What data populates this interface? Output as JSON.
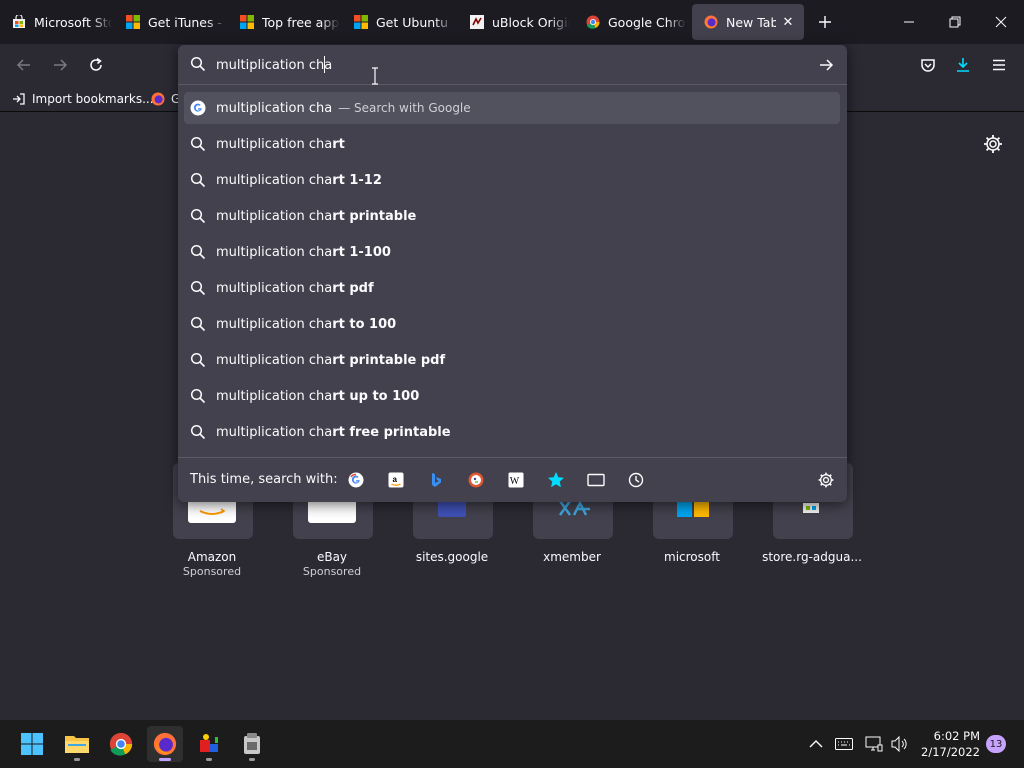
{
  "tabs": [
    {
      "title": "Microsoft Sto",
      "favicon": "ms-store-icon"
    },
    {
      "title": "Get iTunes - M",
      "favicon": "ms-logo-icon"
    },
    {
      "title": "Top free apps",
      "favicon": "ms-logo-icon"
    },
    {
      "title": "Get Ubuntu -",
      "favicon": "ms-logo-icon"
    },
    {
      "title": "uBlock Origin",
      "favicon": "ublock-icon"
    },
    {
      "title": "Google Chron",
      "favicon": "chrome-icon"
    },
    {
      "title": "New Tab",
      "favicon": "firefox-icon",
      "active": true
    }
  ],
  "bookmarks": [
    {
      "label": "Import bookmarks..."
    },
    {
      "label": "G"
    }
  ],
  "urlbar": {
    "value": "multiplication cha",
    "first": {
      "typed": "multiplication cha",
      "suffix": "— Search with Google"
    },
    "suggestions": [
      {
        "typed": "multiplication cha",
        "bold": "rt"
      },
      {
        "typed": "multiplication cha",
        "bold": "rt 1-12"
      },
      {
        "typed": "multiplication cha",
        "bold": "rt printable"
      },
      {
        "typed": "multiplication cha",
        "bold": "rt 1-100"
      },
      {
        "typed": "multiplication cha",
        "bold": "rt pdf"
      },
      {
        "typed": "multiplication cha",
        "bold": "rt to 100"
      },
      {
        "typed": "multiplication cha",
        "bold": "rt printable pdf"
      },
      {
        "typed": "multiplication cha",
        "bold": "rt up to 100"
      },
      {
        "typed": "multiplication cha",
        "bold": "rt free printable"
      }
    ],
    "onesearch_label": "This time, search with:",
    "engines": [
      "google-icon",
      "amazon-icon",
      "bing-icon",
      "duckduckgo-icon",
      "wikipedia-icon",
      "bookmarks-star-icon",
      "tabs-icon",
      "history-icon"
    ]
  },
  "top_sites": [
    {
      "label": "Amazon",
      "sub": "Sponsored"
    },
    {
      "label": "eBay",
      "sub": "Sponsored"
    },
    {
      "label": "sites.google",
      "sub": ""
    },
    {
      "label": "xmember",
      "sub": ""
    },
    {
      "label": "microsoft",
      "sub": ""
    },
    {
      "label": "store.rg-adgua...",
      "sub": ""
    }
  ],
  "taskbar": {
    "time": "6:02 PM",
    "date": "2/17/2022",
    "notifications": "13"
  },
  "colors": {
    "tabstrip": "#1c1b22",
    "toolbar": "#2b2a33",
    "panel": "#42414d",
    "accent": "#00ddff",
    "taskbar": "#1c1c1c"
  }
}
